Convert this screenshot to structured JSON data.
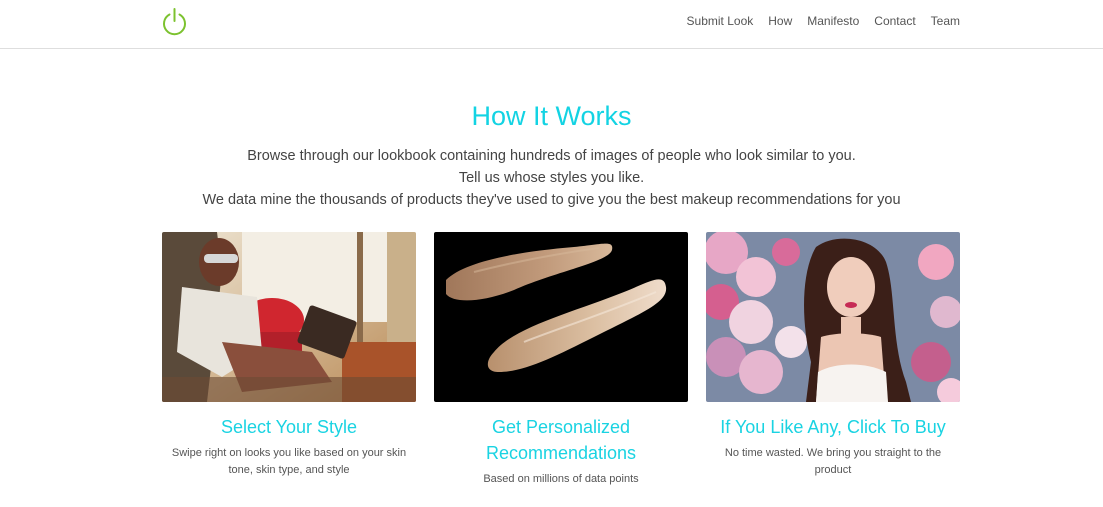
{
  "nav": {
    "logo": "power-icon",
    "links": [
      "Submit Look",
      "How",
      "Manifesto",
      "Contact",
      "Team"
    ]
  },
  "section": {
    "title": "How It Works",
    "intro": [
      "Browse through our lookbook containing hundreds of images of people who look similar to you.",
      "Tell us whose styles you like.",
      "We data mine the thousands of products they've used to give you the best makeup recommendations for you"
    ]
  },
  "cards": [
    {
      "heading": "Select Your Style",
      "desc": "Swipe right on looks you like based on your skin tone, skin type, and style"
    },
    {
      "heading": "Get Personalized Recommendations",
      "desc": "Based on millions of data points"
    },
    {
      "heading": "If You Like Any, Click To Buy",
      "desc": "No time wasted. We bring you straight to the product"
    }
  ],
  "colors": {
    "accent": "#13d3e3",
    "logo": "#7cc22f"
  }
}
